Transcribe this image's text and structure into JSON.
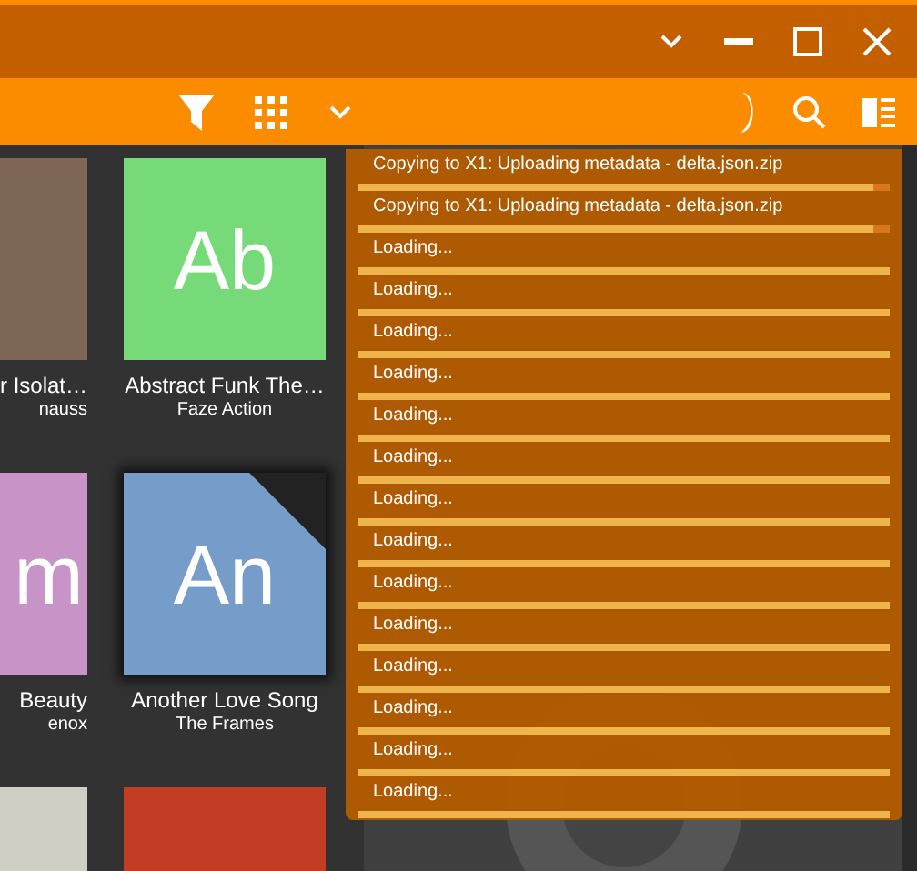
{
  "albums": [
    {
      "title": "r Isolat…",
      "artist": "nauss",
      "color": "#7f6756",
      "selected": false
    },
    {
      "letter": "Ab",
      "title": "Abstract Funk The…",
      "artist": "Faze Action",
      "color": "#76da78",
      "selected": false
    },
    {
      "letter": "m",
      "title": "Beauty",
      "artist": "enox",
      "color": "#c894c7",
      "selected": false
    },
    {
      "letter": "An",
      "title": "Another Love Song",
      "artist": "The Frames",
      "color": "#769dc9",
      "selected": true
    },
    {
      "color": "#cfcfc5",
      "selected": false
    },
    {
      "color": "#c33c24",
      "selected": false
    }
  ],
  "tasks": [
    {
      "label": "Copying to X1: Uploading metadata - delta.json.zip",
      "level": 0.97
    },
    {
      "label": "Copying to X1: Uploading metadata - delta.json.zip",
      "level": 0.97
    },
    {
      "label": "Loading...",
      "level": 1
    },
    {
      "label": "Loading...",
      "level": 1
    },
    {
      "label": "Loading...",
      "level": 1
    },
    {
      "label": "Loading...",
      "level": 1
    },
    {
      "label": "Loading...",
      "level": 1
    },
    {
      "label": "Loading...",
      "level": 1
    },
    {
      "label": "Loading...",
      "level": 1
    },
    {
      "label": "Loading...",
      "level": 1
    },
    {
      "label": "Loading...",
      "level": 1
    },
    {
      "label": "Loading...",
      "level": 1
    },
    {
      "label": "Loading...",
      "level": 1
    },
    {
      "label": "Loading...",
      "level": 1
    },
    {
      "label": "Loading...",
      "level": 1
    },
    {
      "label": "Loading...",
      "level": 1
    }
  ]
}
